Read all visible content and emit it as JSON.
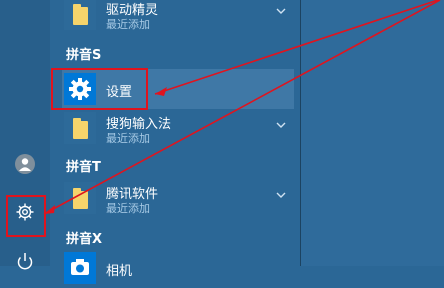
{
  "sections": [
    {
      "header": "",
      "apps": [
        {
          "name": "驱动精灵",
          "sub": "最近添加",
          "icon": "folder-icon",
          "expandable": true
        }
      ]
    },
    {
      "header": "拼音S",
      "apps": [
        {
          "name": "设置",
          "sub": "",
          "icon": "gear-icon",
          "expandable": false,
          "selected": true
        },
        {
          "name": "搜狗输入法",
          "sub": "最近添加",
          "icon": "folder-icon",
          "expandable": true
        }
      ]
    },
    {
      "header": "拼音T",
      "apps": [
        {
          "name": "腾讯软件",
          "sub": "最近添加",
          "icon": "folder-icon",
          "expandable": true
        }
      ]
    },
    {
      "header": "拼音X",
      "apps": [
        {
          "name": "相机",
          "sub": "",
          "icon": "camera-icon",
          "expandable": false
        }
      ]
    }
  ],
  "rail": {
    "items": [
      {
        "icon": "user-icon"
      },
      {
        "icon": "gear-icon",
        "highlighted": true
      },
      {
        "icon": "power-icon"
      }
    ]
  },
  "colors": {
    "annotation": "#e0141e",
    "tile_blue": "#0078d7",
    "folder_yellow": "#f6d46b"
  }
}
